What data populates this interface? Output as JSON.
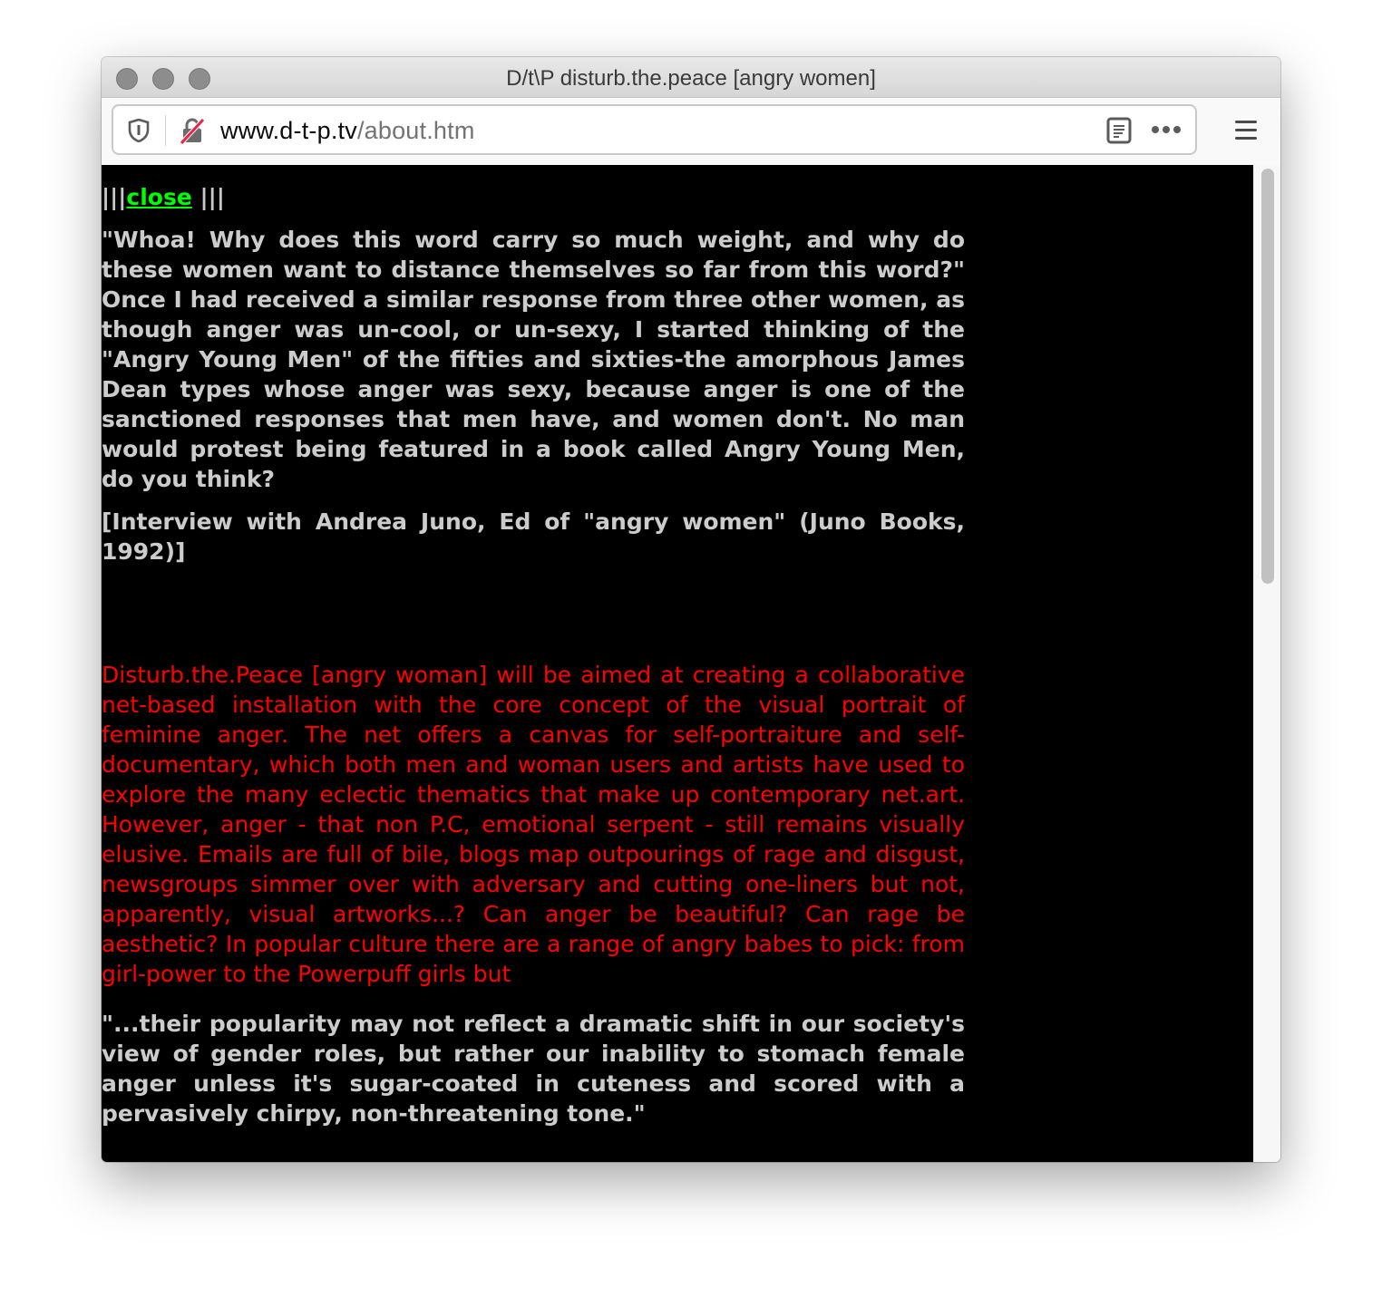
{
  "window": {
    "title": "D/t\\P disturb.the.peace [angry women]"
  },
  "toolbar": {
    "url_domain": "www.d-t-p.tv",
    "url_path": "/about.htm"
  },
  "page": {
    "nav_prefix": "|||",
    "close_link": "close",
    "nav_suffix": " |||",
    "quote1": "\"Whoa! Why does this word carry so much weight, and why do these women want to distance themselves so far from this word?\" Once I had received a similar response from three other women, as though anger was un-cool, or un-sexy, I started thinking of the \"Angry Young Men\" of the fifties and sixties-the amorphous James Dean types whose anger was sexy, because anger is one of the sanctioned responses that men have, and women don't. No man would protest being featured in a book called Angry Young Men, do you think?",
    "citation": "[Interview with Andrea Juno, Ed of \"angry women\" (Juno Books, 1992)]",
    "red_paragraph": "Disturb.the.Peace [angry woman] will be aimed at creating a collaborative net-based installation with the core concept of the visual portrait of feminine anger. The net offers a canvas for self-portraiture and self-documentary, which both men and woman users and artists have used to explore the many eclectic thematics that make up contemporary net.art. However, anger - that non P.C, emotional serpent - still remains visually elusive. Emails are full of bile, blogs map outpourings of rage and disgust, newsgroups simmer over with adversary and cutting one-liners but not, apparently, visual artworks...? Can anger be beautiful? Can rage be aesthetic? In popular culture there are a range of angry babes to pick: from girl-power to the Powerpuff girls but",
    "quote2": "\"...their popularity may not reflect a dramatic shift in our society's view of gender roles, but rather our inability to stomach female anger unless it's sugar-coated in cuteness and scored with a pervasively chirpy, non-threatening tone.\""
  },
  "colors": {
    "background": "#000000",
    "link": "#00ff00",
    "body_text": "#cccccc",
    "accent_text": "#ff0000"
  }
}
